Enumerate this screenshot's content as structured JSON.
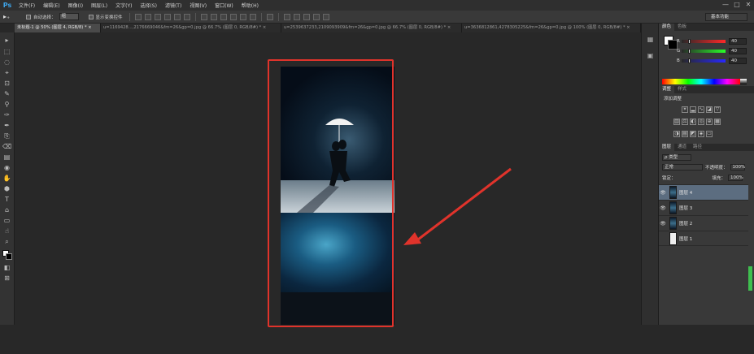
{
  "app": {
    "logo": "Ps"
  },
  "menu": [
    "文件(F)",
    "编辑(E)",
    "图像(I)",
    "图层(L)",
    "文字(Y)",
    "选择(S)",
    "滤镜(T)",
    "视图(V)",
    "窗口(W)",
    "帮助(H)"
  ],
  "window_controls": [
    "—",
    "□",
    "✕"
  ],
  "options": {
    "tool": "▸₊",
    "auto_select_label": "自动选择：",
    "auto_select_value": "组",
    "show_transform_label": "显示变换控件"
  },
  "workspace": "基本功能",
  "tabs": [
    "未标题-1 @ 50% (图层 4, RGB/8) * ×",
    "u=1169428...,2176669046&fm=26&gp=0.jpg @ 66.7% (图层 0, RGB/8#) * ×",
    "u=2539637233,2109093909&fm=26&gp=0.jpg @ 66.7% (图层 0, RGB/8#) * ×",
    "u=3636812861,4278305225&fm=26&gp=0.jpg @ 100% (图层 0, RGB/8#) * ×"
  ],
  "tools": [
    "▸",
    "⬚",
    "◌",
    "⌖",
    "⊡",
    "✎",
    "⚲",
    "✑",
    "✒",
    "⎘",
    "⌫",
    "▤",
    "◉",
    "✋",
    "⬢",
    "T",
    "⌂",
    "▭",
    "☝",
    "⌕",
    "◧",
    "⊞"
  ],
  "color_panel": {
    "tabs": [
      "颜色",
      "色板"
    ],
    "fg": "#ffffff",
    "bg": "#000000",
    "sliders": [
      {
        "label": "R",
        "value": "40",
        "color": "#e04040"
      },
      {
        "label": "G",
        "value": "40",
        "color": "#40c040"
      },
      {
        "label": "B",
        "value": "40",
        "color": "#4060e0"
      }
    ]
  },
  "adjust_panel": {
    "tabs": [
      "调整",
      "样式"
    ],
    "title": "添加调整"
  },
  "layers_panel": {
    "tabs": [
      "图层",
      "通道",
      "路径"
    ],
    "kind_filter": "ρ 类型",
    "blend_mode": "正常",
    "opacity_label": "不透明度：",
    "opacity_value": "100%",
    "lock_label": "锁定：",
    "fill_label": "填充：",
    "fill_value": "100%",
    "layers": [
      {
        "name": "图层 4",
        "visible": true,
        "selected": true
      },
      {
        "name": "图层 3",
        "visible": true,
        "selected": false
      },
      {
        "name": "图层 2",
        "visible": true,
        "selected": false
      },
      {
        "name": "图层 1",
        "visible": false,
        "selected": false
      }
    ]
  },
  "annotation_color": "#e0332b"
}
